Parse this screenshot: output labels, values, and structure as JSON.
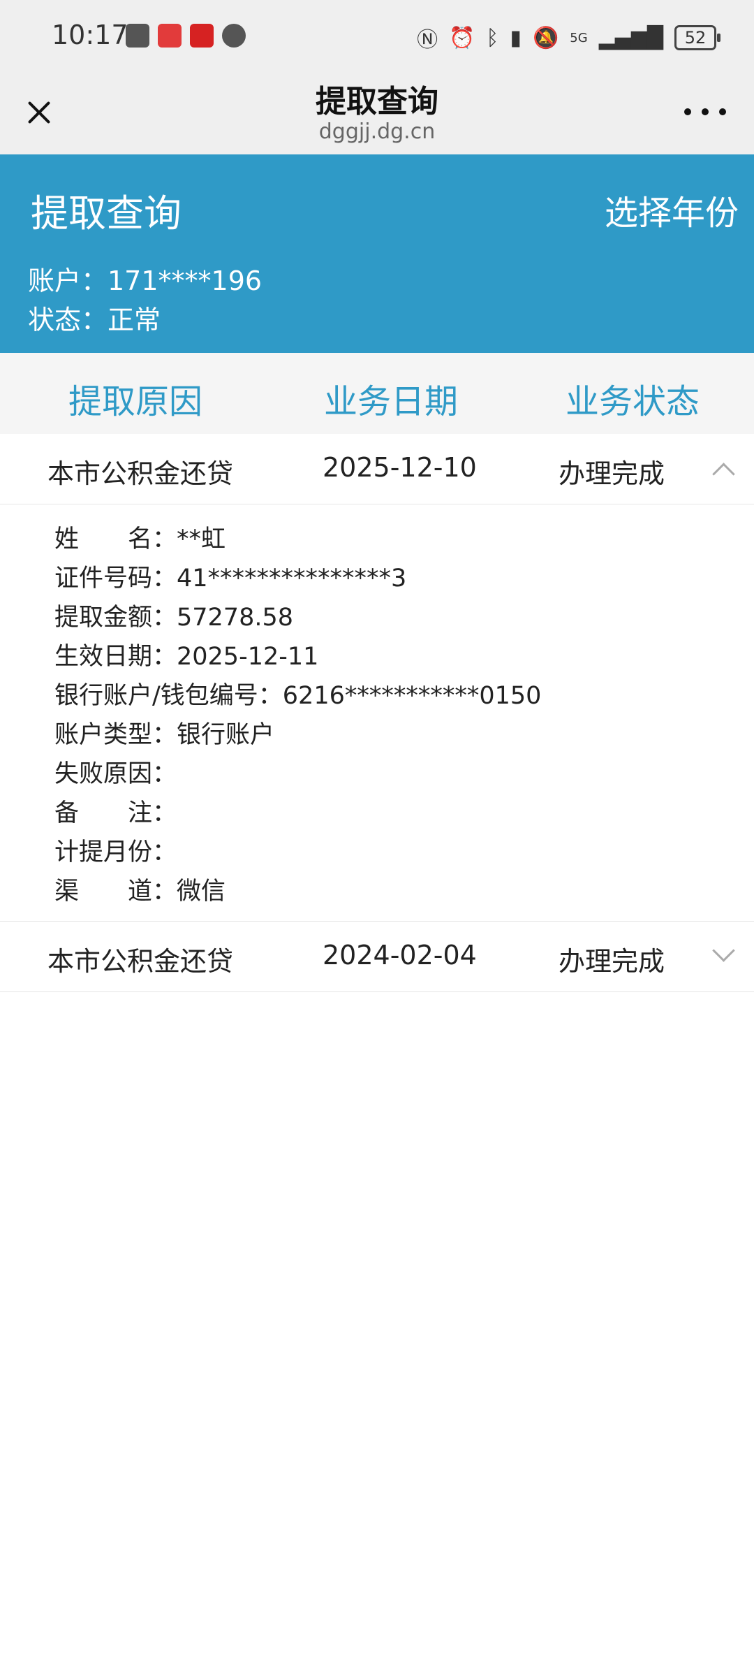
{
  "status_bar": {
    "time": "10:17",
    "network": "5G",
    "battery": "52",
    "icons": [
      "notification-icon",
      "app-icon",
      "app-icon",
      "message-icon",
      "nfc-icon",
      "alarm-icon",
      "bluetooth-icon",
      "battery-saver-icon",
      "mute-icon",
      "signal-icon"
    ]
  },
  "header": {
    "title": "提取查询",
    "domain": "dggjj.dg.cn"
  },
  "banner": {
    "title": "提取查询",
    "year_button": "选择年份",
    "account_line": "账户：171****196",
    "status_line": "状态：正常",
    "color": "#2f9ac7"
  },
  "columns": [
    "提取原因",
    "业务日期",
    "业务状态"
  ],
  "records": [
    {
      "reason": "本市公积金还贷",
      "date": "2025-12-10",
      "status": "办理完成",
      "expanded": true,
      "details": [
        "姓　　名：**虹",
        "证件号码：41***************3",
        "提取金额：57278.58",
        "生效日期：2025-12-11",
        "银行账户/钱包编号：6216***********0150",
        "账户类型：银行账户",
        "失败原因：",
        "备　　注：",
        "计提月份：",
        "渠　　道：微信"
      ]
    },
    {
      "reason": "本市公积金还贷",
      "date": "2024-02-04",
      "status": "办理完成",
      "expanded": false
    }
  ]
}
